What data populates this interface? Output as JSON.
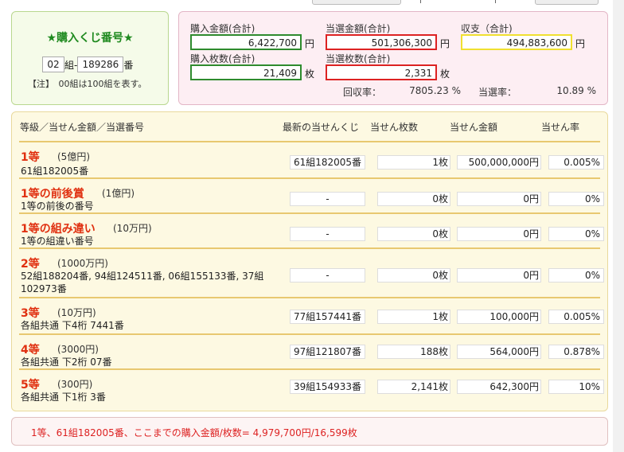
{
  "ticket": {
    "title": "★購入くじ番号★",
    "group_value": "02",
    "group_suffix": "組-",
    "number_value": "189286",
    "number_suffix": "番",
    "note": "【注】　00組は100組を表す。"
  },
  "totals": {
    "purchase_amount_label": "購入金額(合計)",
    "purchase_amount": "6,422,700",
    "winning_amount_label": "当選金額(合計)",
    "winning_amount": "501,306,300",
    "balance_label": "収支（合計)",
    "balance": "494,883,600",
    "purchase_count_label": "購入枚数(合計)",
    "purchase_count": "21,409",
    "winning_count_label": "当選枚数(合計)",
    "winning_count": "2,331",
    "yen_unit": "円",
    "count_unit": "枚",
    "return_rate_label": "回収率：",
    "return_rate": "7805.23 %",
    "win_rate_label": "当選率：",
    "win_rate": "10.89 %"
  },
  "table": {
    "headers": {
      "prize": "等級／当せん金額／当選番号",
      "latest": "最新の当せんくじ",
      "count": "当せん枚数",
      "amount": "当せん金額",
      "rate": "当せん率"
    },
    "rows": [
      {
        "name": "1等",
        "amount": "(5億円)",
        "desc": "61組182005番",
        "latest": "61組182005番",
        "count": "1枚",
        "money": "500,000,000円",
        "rate": "0.005%"
      },
      {
        "name": "1等の前後賞",
        "amount": "(1億円)",
        "desc": "1等の前後の番号",
        "latest": "-",
        "count": "0枚",
        "money": "0円",
        "rate": "0%"
      },
      {
        "name": "1等の組み違い",
        "amount": "(10万円)",
        "desc": "1等の組違い番号",
        "latest": "-",
        "count": "0枚",
        "money": "0円",
        "rate": "0%"
      },
      {
        "name": "2等",
        "amount": "(1000万円)",
        "desc": "52組188204番, 94組124511番, 06組155133番, 37組",
        "desc2": "102973番",
        "latest": "-",
        "count": "0枚",
        "money": "0円",
        "rate": "0%"
      },
      {
        "name": "3等",
        "amount": "(10万円)",
        "desc": "各組共通 下4桁 7441番",
        "latest": "77組157441番",
        "count": "1枚",
        "money": "100,000円",
        "rate": "0.005%"
      },
      {
        "name": "4等",
        "amount": "(3000円)",
        "desc": "各組共通 下2桁 07番",
        "latest": "97組121807番",
        "count": "188枚",
        "money": "564,000円",
        "rate": "0.878%"
      },
      {
        "name": "5等",
        "amount": "(300円)",
        "desc": "各組共通 下1桁 3番",
        "latest": "39組154933番",
        "count": "2,141枚",
        "money": "642,300円",
        "rate": "10%"
      }
    ]
  },
  "status": {
    "message": "1等、61組182005番、ここまでの購入金額/枚数= 4,979,700円/16,599枚"
  }
}
